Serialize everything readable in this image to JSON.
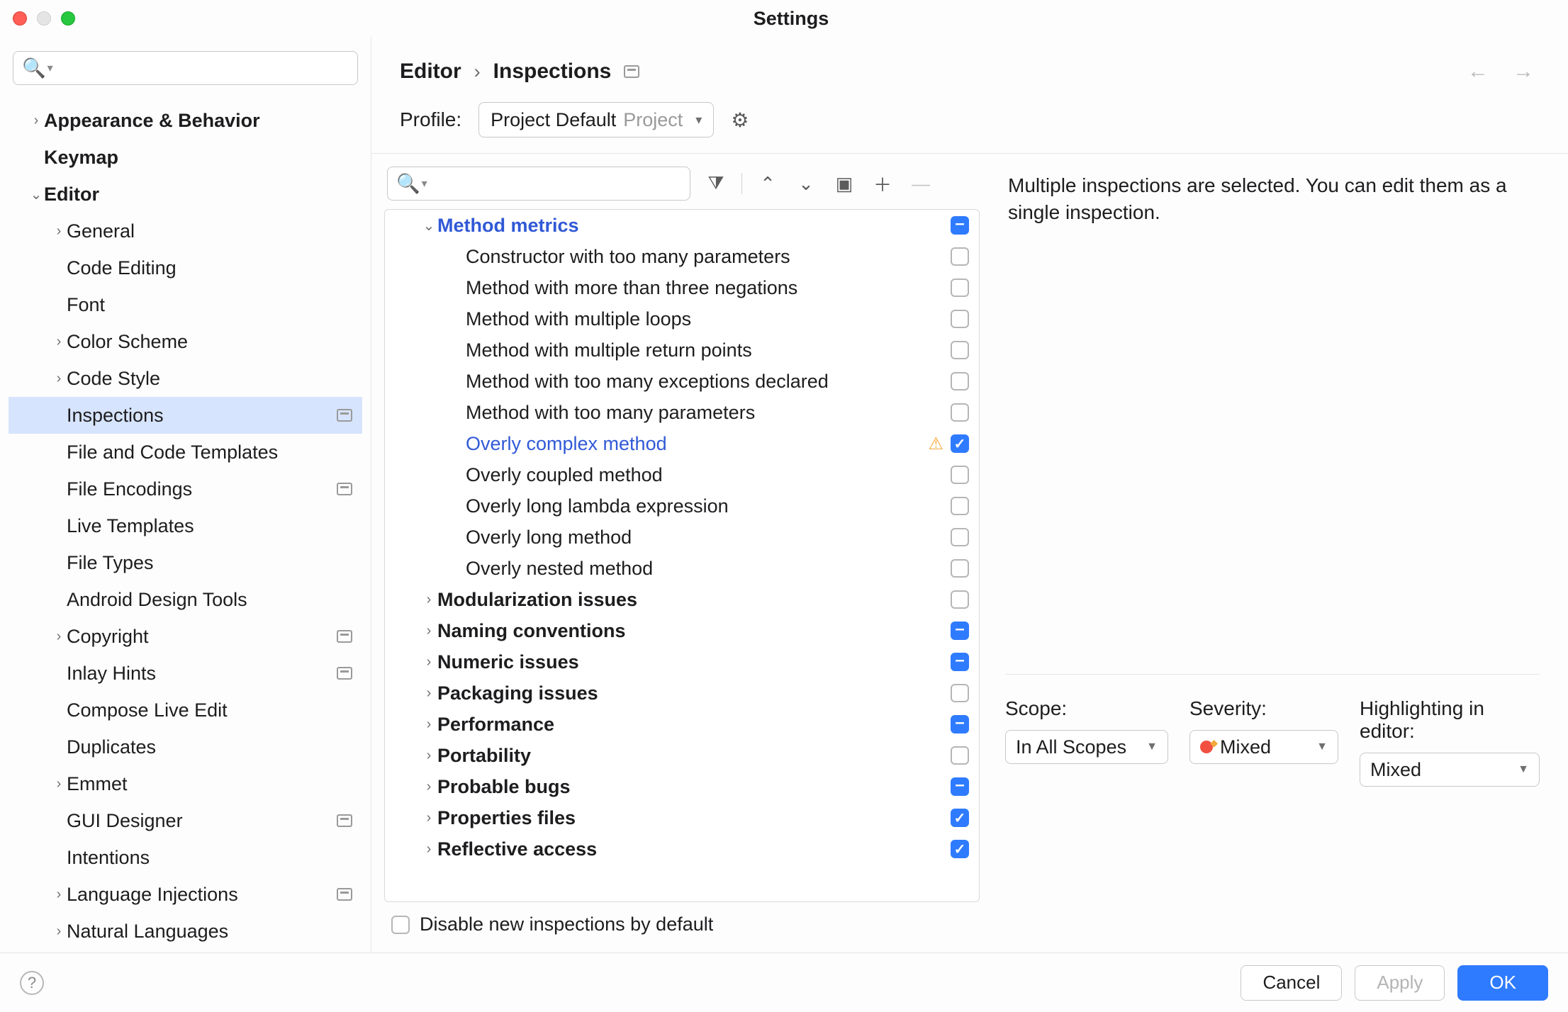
{
  "window": {
    "title": "Settings"
  },
  "breadcrumb": {
    "a": "Editor",
    "b": "Inspections"
  },
  "profile": {
    "label": "Profile:",
    "value": "Project Default",
    "hint": "Project"
  },
  "sidebar": {
    "items": [
      {
        "label": "Appearance & Behavior",
        "indent": 0,
        "arrow": "right",
        "bold": true
      },
      {
        "label": "Keymap",
        "indent": 0,
        "arrow": "",
        "bold": true
      },
      {
        "label": "Editor",
        "indent": 0,
        "arrow": "down",
        "bold": true
      },
      {
        "label": "General",
        "indent": 1,
        "arrow": "right"
      },
      {
        "label": "Code Editing",
        "indent": 1,
        "arrow": ""
      },
      {
        "label": "Font",
        "indent": 1,
        "arrow": ""
      },
      {
        "label": "Color Scheme",
        "indent": 1,
        "arrow": "right"
      },
      {
        "label": "Code Style",
        "indent": 1,
        "arrow": "right"
      },
      {
        "label": "Inspections",
        "indent": 1,
        "arrow": "",
        "badge": true,
        "selected": true
      },
      {
        "label": "File and Code Templates",
        "indent": 1,
        "arrow": ""
      },
      {
        "label": "File Encodings",
        "indent": 1,
        "arrow": "",
        "badge": true
      },
      {
        "label": "Live Templates",
        "indent": 1,
        "arrow": ""
      },
      {
        "label": "File Types",
        "indent": 1,
        "arrow": ""
      },
      {
        "label": "Android Design Tools",
        "indent": 1,
        "arrow": ""
      },
      {
        "label": "Copyright",
        "indent": 1,
        "arrow": "right",
        "badge": true
      },
      {
        "label": "Inlay Hints",
        "indent": 1,
        "arrow": "",
        "badge": true
      },
      {
        "label": "Compose Live Edit",
        "indent": 1,
        "arrow": ""
      },
      {
        "label": "Duplicates",
        "indent": 1,
        "arrow": ""
      },
      {
        "label": "Emmet",
        "indent": 1,
        "arrow": "right"
      },
      {
        "label": "GUI Designer",
        "indent": 1,
        "arrow": "",
        "badge": true
      },
      {
        "label": "Intentions",
        "indent": 1,
        "arrow": ""
      },
      {
        "label": "Language Injections",
        "indent": 1,
        "arrow": "right",
        "badge": true
      },
      {
        "label": "Natural Languages",
        "indent": 1,
        "arrow": "right"
      }
    ]
  },
  "inspections": {
    "rows": [
      {
        "label": "Method metrics",
        "indent": 0,
        "arrow": "down",
        "group": true,
        "sel": true,
        "state": "mixed"
      },
      {
        "label": "Constructor with too many parameters",
        "indent": 1,
        "state": "off"
      },
      {
        "label": "Method with more than three negations",
        "indent": 1,
        "state": "off"
      },
      {
        "label": "Method with multiple loops",
        "indent": 1,
        "state": "off"
      },
      {
        "label": "Method with multiple return points",
        "indent": 1,
        "state": "off"
      },
      {
        "label": "Method with too many exceptions declared",
        "indent": 1,
        "state": "off"
      },
      {
        "label": "Method with too many parameters",
        "indent": 1,
        "state": "off"
      },
      {
        "label": "Overly complex method",
        "indent": 1,
        "state": "on",
        "blue": true,
        "warn": true
      },
      {
        "label": "Overly coupled method",
        "indent": 1,
        "state": "off"
      },
      {
        "label": "Overly long lambda expression",
        "indent": 1,
        "state": "off"
      },
      {
        "label": "Overly long method",
        "indent": 1,
        "state": "off"
      },
      {
        "label": "Overly nested method",
        "indent": 1,
        "state": "off"
      },
      {
        "label": "Modularization issues",
        "indent": 0,
        "arrow": "right",
        "group": true,
        "state": "off"
      },
      {
        "label": "Naming conventions",
        "indent": 0,
        "arrow": "right",
        "group": true,
        "state": "mixed"
      },
      {
        "label": "Numeric issues",
        "indent": 0,
        "arrow": "right",
        "group": true,
        "state": "mixed"
      },
      {
        "label": "Packaging issues",
        "indent": 0,
        "arrow": "right",
        "group": true,
        "state": "off"
      },
      {
        "label": "Performance",
        "indent": 0,
        "arrow": "right",
        "group": true,
        "state": "mixed"
      },
      {
        "label": "Portability",
        "indent": 0,
        "arrow": "right",
        "group": true,
        "state": "off"
      },
      {
        "label": "Probable bugs",
        "indent": 0,
        "arrow": "right",
        "group": true,
        "state": "mixed"
      },
      {
        "label": "Properties files",
        "indent": 0,
        "arrow": "right",
        "group": true,
        "state": "on"
      },
      {
        "label": "Reflective access",
        "indent": 0,
        "arrow": "right",
        "group": true,
        "state": "on"
      }
    ]
  },
  "disable_new": {
    "label": "Disable new inspections by default"
  },
  "right": {
    "info": "Multiple inspections are selected. You can edit them as a single inspection.",
    "scope_label": "Scope:",
    "scope_value": "In All Scopes",
    "severity_label": "Severity:",
    "severity_value": "Mixed",
    "highlight_label": "Highlighting in editor:",
    "highlight_value": "Mixed"
  },
  "footer": {
    "cancel": "Cancel",
    "apply": "Apply",
    "ok": "OK"
  }
}
